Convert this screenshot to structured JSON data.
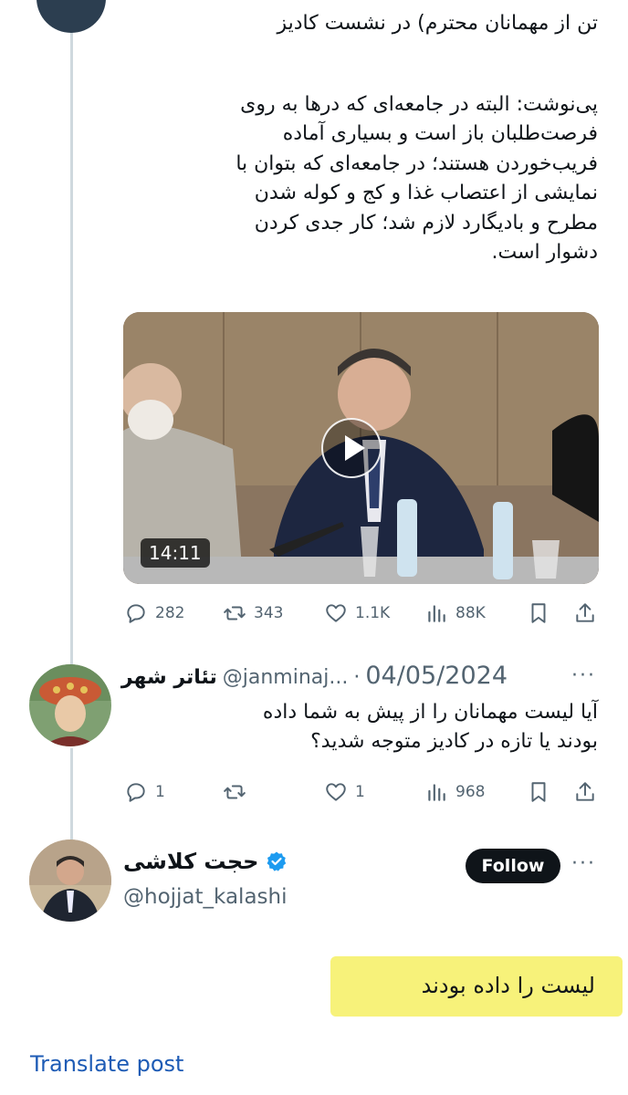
{
  "parent_tweet": {
    "text_lines": [
      "تن از مهمانان محترم) در نشست کادیز",
      "",
      "پی‌نوشت: البته در جامعه‌ای که درها به روی",
      "فرصت‌طلبان باز است و بسیاری آماده",
      "فریب‌خوردن هستند؛ در جامعه‌ای که بتوان با",
      "نمایشی از اعتصاب غذا و کج و کوله شدن",
      "مطرح و بادیگارد لازم شد؛ کار جدی کردن",
      "دشوار است."
    ],
    "video": {
      "duration": "14:11",
      "icon": "play-icon"
    },
    "actions": {
      "replies": "282",
      "retweets": "343",
      "likes": "1.1K",
      "views": "88K"
    }
  },
  "reply_tweet": {
    "name": "تئاتر شهر",
    "handle": "@janminaj...",
    "separator": "·",
    "date": "04/05/2024",
    "text_lines": [
      "آیا لیست مهمانان را از پیش به شما داده",
      "بودند یا تازه در کادیز متوجه شدید؟"
    ],
    "actions": {
      "replies": "1",
      "retweets": "",
      "likes": "1",
      "views": "968"
    }
  },
  "main_tweet": {
    "name": "حجت کلاشی",
    "handle": "@hojjat_kalashi",
    "follow_label": "Follow",
    "text": "لیست را داده بودند",
    "translate_label": "Translate post",
    "colors": {
      "highlight": "#f7f27a",
      "verified": "#1d9bf0",
      "link": "#1d5bb5"
    }
  }
}
